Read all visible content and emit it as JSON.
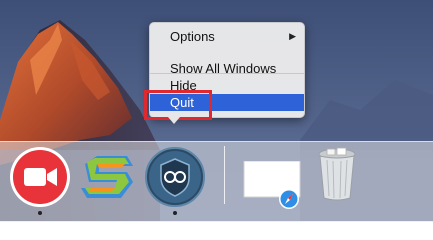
{
  "context_menu": {
    "items": [
      {
        "label": "Options",
        "has_submenu": true
      },
      {
        "label": "Show All Windows"
      },
      {
        "label": "Hide"
      },
      {
        "label": "Quit",
        "selected": true
      }
    ],
    "submenu_arrow": "▶"
  },
  "dock": {
    "apps": [
      {
        "icon": "red-video-camera-icon",
        "running": true
      },
      {
        "icon": "green-s-logo-app-icon",
        "running": false
      },
      {
        "icon": "shield-vpn-app-icon",
        "running": true
      },
      {
        "icon": "white-window-thumbnail-icon",
        "running": false
      },
      {
        "icon": "trash-icon",
        "running": false
      }
    ]
  },
  "colors": {
    "selection": "#2d62d9",
    "highlight_border": "#e0282f",
    "menu_bg": "#ececec"
  }
}
